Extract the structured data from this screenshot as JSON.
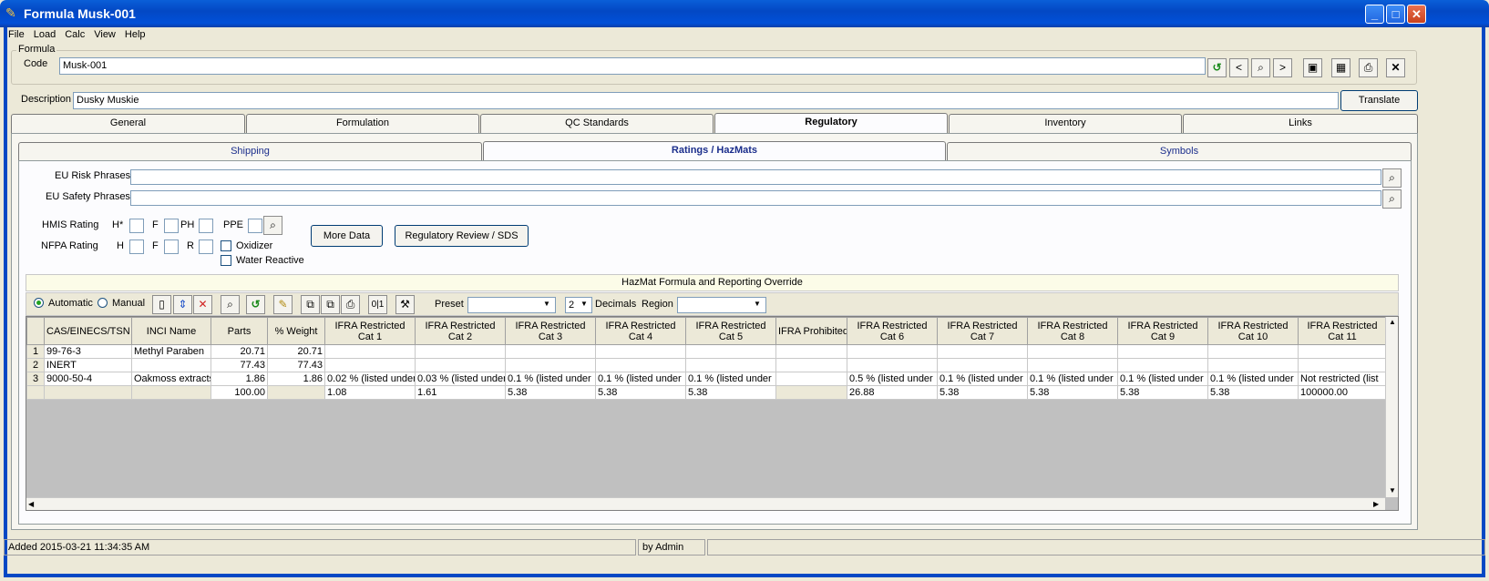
{
  "window": {
    "title": "Formula Musk-001"
  },
  "menu": [
    "File",
    "Load",
    "Calc",
    "View",
    "Help"
  ],
  "formula": {
    "group_label": "Formula",
    "code_label": "Code",
    "code_value": "Musk-001",
    "desc_label": "Description",
    "desc_value": "Dusky Muskie",
    "translate": "Translate"
  },
  "tabs": [
    "General",
    "Formulation",
    "QC Standards",
    "Regulatory",
    "Inventory",
    "Links"
  ],
  "subtabs": [
    "Shipping",
    "Ratings / HazMats",
    "Symbols"
  ],
  "regulatory": {
    "eu_risk": "EU Risk Phrases",
    "eu_safety": "EU Safety Phrases",
    "hmis": "HMIS Rating",
    "hmis_h": "H*",
    "hmis_f": "F",
    "hmis_ph": "PH",
    "hmis_ppe": "PPE",
    "nfpa": "NFPA Rating",
    "nfpa_h": "H",
    "nfpa_f": "F",
    "nfpa_r": "R",
    "oxidizer": "Oxidizer",
    "water_reactive": "Water Reactive",
    "more_data": "More Data",
    "review": "Regulatory Review / SDS"
  },
  "hazmat": {
    "header": "HazMat Formula and Reporting Override",
    "automatic": "Automatic",
    "manual": "Manual",
    "preset": "Preset",
    "decimals_value": "2",
    "decimals": "Decimals",
    "region": "Region"
  },
  "grid": {
    "columns": [
      "CAS/EINECS/TSN",
      "INCI Name",
      "Parts",
      "% Weight",
      "IFRA Restricted Cat 1",
      "IFRA Restricted Cat 2",
      "IFRA Restricted Cat 3",
      "IFRA Restricted Cat 4",
      "IFRA Restricted Cat 5",
      "IFRA Prohibited",
      "IFRA Restricted Cat 6",
      "IFRA Restricted Cat 7",
      "IFRA Restricted Cat 8",
      "IFRA Restricted Cat 9",
      "IFRA Restricted Cat 10",
      "IFRA Restricted Cat 11"
    ],
    "rows": [
      [
        "1",
        "99-76-3",
        "Methyl Paraben",
        "20.71",
        "20.71",
        "",
        "",
        "",
        "",
        "",
        "",
        "",
        "",
        "",
        "",
        "",
        ""
      ],
      [
        "2",
        "INERT",
        "",
        "77.43",
        "77.43",
        "",
        "",
        "",
        "",
        "",
        "",
        "",
        "",
        "",
        "",
        "",
        ""
      ],
      [
        "3",
        "9000-50-4",
        "Oakmoss extracts",
        "1.86",
        "1.86",
        "0.02 % (listed under",
        "0.03 % (listed under",
        "0.1 % (listed under",
        "0.1 % (listed under",
        "0.1 % (listed under",
        "",
        "0.5 % (listed under",
        "0.1 % (listed under",
        "0.1 % (listed under",
        "0.1 % (listed under",
        "0.1 % (listed under",
        "Not restricted (list"
      ]
    ],
    "totals": [
      "",
      "",
      "",
      "100.00",
      "",
      "1.08",
      "1.61",
      "5.38",
      "5.38",
      "5.38",
      "",
      "26.88",
      "5.38",
      "5.38",
      "5.38",
      "5.38",
      "100000.00"
    ]
  },
  "status": {
    "added": "Added 2015-03-21 11:34:35 AM",
    "by": "by Admin"
  }
}
